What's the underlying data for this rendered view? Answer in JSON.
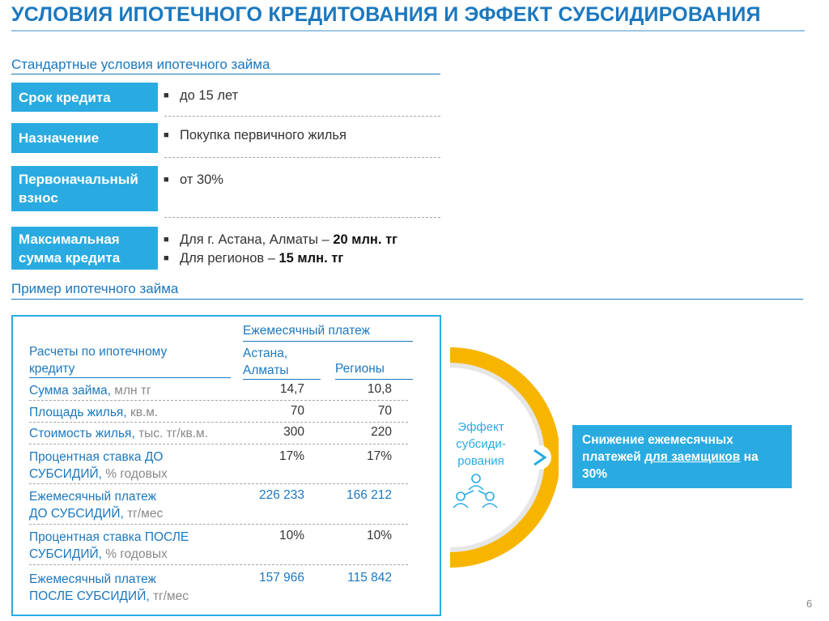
{
  "title": "УСЛОВИЯ ИПОТЕЧНОГО КРЕДИТОВАНИЯ И ЭФФЕКТ СУБСИДИРОВАНИЯ",
  "standard": {
    "heading": "Стандартные условия ипотечного займа",
    "rows": [
      {
        "label": "Срок кредита",
        "text": "до 15 лет"
      },
      {
        "label": "Назначение",
        "text": "Покупка первичного жилья"
      },
      {
        "label_line1": "Первоначальный",
        "label_line2": "взнос",
        "text": "от 30%"
      },
      {
        "label_line1": "Максимальная",
        "label_line2": "сумма кредита",
        "line1_prefix": "Для г. Астана, Алматы – ",
        "line1_bold": "20 млн. тг",
        "line2_prefix": "Для регионов – ",
        "line2_bold": "15 млн. тг"
      }
    ]
  },
  "example": {
    "heading": "Пример ипотечного займа",
    "table": {
      "header_left_line1": "Расчеты по ипотечному",
      "header_left_line2": "кредиту",
      "header_group": "Ежемесячный платеж",
      "col1_line1": "Астана,",
      "col1_line2": "Алматы",
      "col2": "Регионы",
      "rows": [
        {
          "label": "Сумма займа, ",
          "unit": "млн тг",
          "v1": "14,7",
          "v2": "10,8"
        },
        {
          "label": "Площадь жилья, ",
          "unit": "кв.м.",
          "v1": "70",
          "v2": "70"
        },
        {
          "label": "Стоимость жилья, ",
          "unit": "тыс. тг/кв.м.",
          "v1": "300",
          "v2": "220"
        },
        {
          "line1": "Процентная ставка ДО",
          "line2": "СУБСИДИЙ, ",
          "unit": "% годовых",
          "v1": "17%",
          "v2": "17%"
        },
        {
          "line1": "Ежемесячный платеж",
          "line2": "ДО СУБСИДИЙ, ",
          "unit": "тг/мес",
          "v1": "226 233",
          "v2": "166 212"
        },
        {
          "line1": "Процентная ставка ПОСЛЕ",
          "line2": "СУБСИДИЙ, ",
          "unit": "% годовых",
          "v1": "10%",
          "v2": "10%"
        },
        {
          "line1": "Ежемесячный платеж",
          "line2": "ПОСЛЕ СУБСИДИЙ, ",
          "unit": "тг/мес",
          "v1": "157 966",
          "v2": "115 842"
        }
      ]
    }
  },
  "effect": {
    "line1": "Эффект",
    "line2": "субсиди-",
    "line3": "рования",
    "icon": "people-group-icon"
  },
  "result": {
    "line1": "Снижение ежемесячных",
    "line2_prefix": "платежей ",
    "line2_underlined": "для заемщиков",
    "line2_suffix": " на",
    "line3": "30%"
  },
  "page_number": "6",
  "colors": {
    "accent": "#29abe2",
    "heading_blue": "#1b78bf",
    "arc_yellow": "#f7b500",
    "arc_grey": "#e6e6e6"
  }
}
